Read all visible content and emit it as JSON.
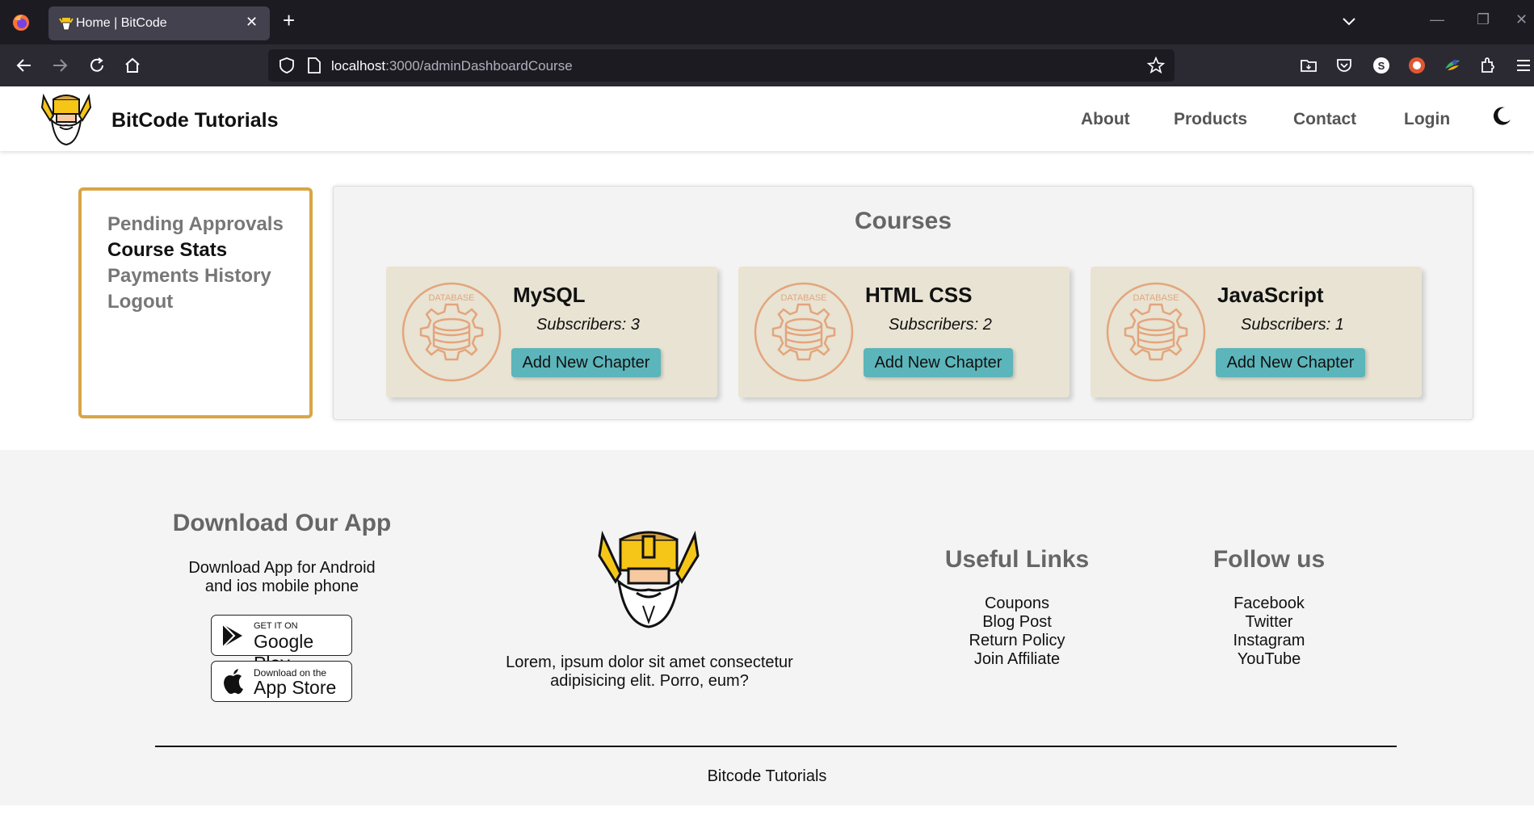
{
  "browser": {
    "tab_title": "Home | BitCode",
    "url_host": "localhost",
    "url_rest": ":3000/adminDashboardCourse"
  },
  "header": {
    "brand": "BitCode Tutorials",
    "menu": [
      "About",
      "Products",
      "Contact",
      "Login"
    ]
  },
  "sidebar": {
    "items": [
      "Pending Approvals",
      "Course Stats",
      "Payments History",
      "Logout"
    ],
    "active": "Course Stats"
  },
  "courses": {
    "title": "Courses",
    "icon_text": "DATABASE",
    "cards": [
      {
        "name": "MySQL",
        "subscribers": "Subscribers: 3",
        "button": "Add New Chapter"
      },
      {
        "name": "HTML CSS",
        "subscribers": "Subscribers: 2",
        "button": "Add New Chapter"
      },
      {
        "name": "JavaScript",
        "subscribers": "Subscribers: 1",
        "button": "Add New Chapter"
      }
    ]
  },
  "footer": {
    "app": {
      "heading": "Download Our App",
      "line1": "Download App for Android",
      "line2": "and ios mobile phone",
      "google_small": "GET IT ON",
      "google_big": "Google Play",
      "apple_small": "Download on the",
      "apple_big": "App Store"
    },
    "about_line1": "Lorem, ipsum dolor sit amet consectetur",
    "about_line2": "adipisicing elit. Porro, eum?",
    "useful": {
      "heading": "Useful Links",
      "items": [
        "Coupons",
        "Blog Post",
        "Return Policy",
        "Join Affiliate"
      ]
    },
    "follow": {
      "heading": "Follow us",
      "items": [
        "Facebook",
        "Twitter",
        "Instagram",
        "YouTube"
      ]
    },
    "copyright": "Bitcode Tutorials"
  },
  "colors": {
    "accent_border": "#d9a546",
    "button": "#5bb5ba",
    "card": "#e8e3d3",
    "icon": "#e3a57c"
  }
}
